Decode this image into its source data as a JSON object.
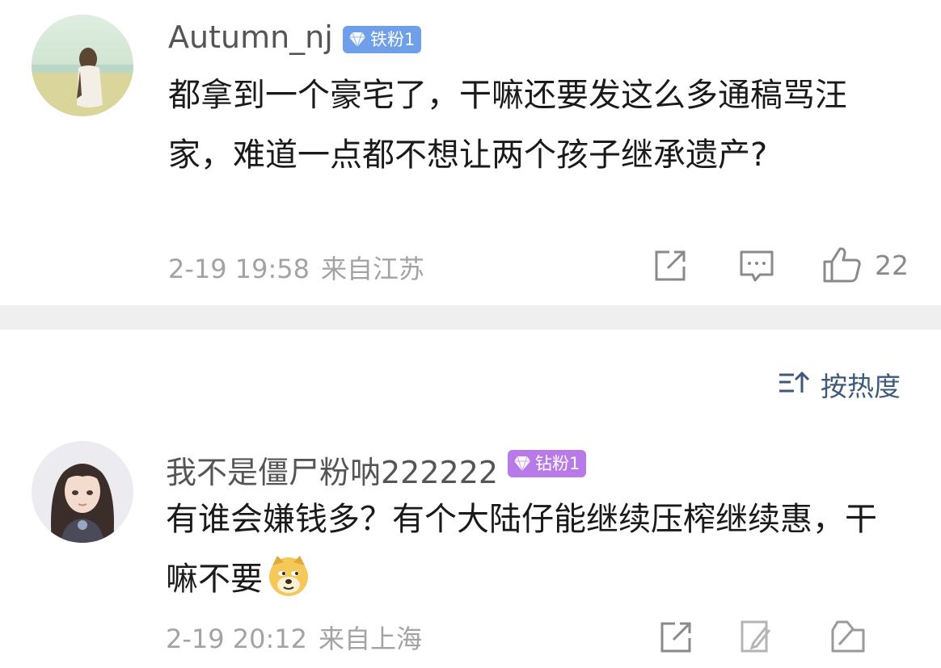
{
  "comments": [
    {
      "username": "Autumn_nj",
      "badge": "铁粉1",
      "badge_color": "#6f9fe9",
      "text": "都拿到一个豪宅了，干嘛还要发这么多通稿骂汪家，难道一点都不想让两个孩子继承遗产?",
      "date": "2-19 19:58",
      "location": "来自江苏",
      "likes": "22",
      "icons": [
        "share-icon",
        "comment-icon",
        "like-icon"
      ]
    },
    {
      "username": "我不是僵尸粉呐222222",
      "badge": "钻粉1",
      "badge_color": "#b77ae8",
      "text": "有谁会嫌钱多？有个大陆仔能继续压榨继续惠，干嘛不要",
      "emoji": "doge-emoji",
      "date": "2-19 20:12",
      "location": "来自上海",
      "icons": [
        "share-icon",
        "comment-icon",
        "like-icon"
      ]
    }
  ],
  "sort": {
    "label": "按热度",
    "icon": "sort-icon"
  },
  "colors": {
    "accent": "#3d5a7d",
    "meta": "#a3a3a3",
    "divider": "#efefef"
  }
}
